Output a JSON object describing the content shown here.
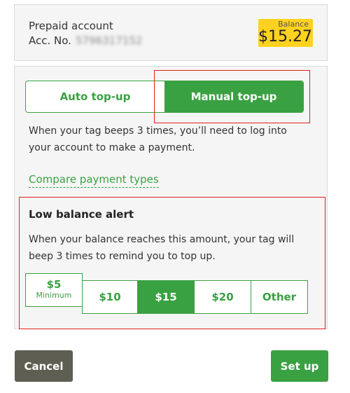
{
  "account": {
    "type_label": "Prepaid account",
    "acc_no_label": "Acc. No.",
    "acc_no_value": "5796317152",
    "balance_label": "Balance",
    "balance_amount": "$15.27"
  },
  "topup": {
    "tabs": [
      {
        "label": "Auto top-up",
        "active": false
      },
      {
        "label": "Manual top-up",
        "active": true
      }
    ],
    "description": "When your tag beeps 3 times, you’ll need to log into your account to make a payment.",
    "compare_link": "Compare payment types"
  },
  "alert": {
    "title": "Low balance alert",
    "description": "When your balance reaches this amount, your tag will beep 3 times to remind you to top up.",
    "amounts": [
      {
        "label": "$5",
        "sublabel": "Minimum",
        "selected": false
      },
      {
        "label": "$10",
        "selected": false
      },
      {
        "label": "$15",
        "selected": true
      },
      {
        "label": "$20",
        "selected": false
      },
      {
        "label": "Other",
        "selected": false
      }
    ]
  },
  "actions": {
    "cancel_label": "Cancel",
    "setup_label": "Set up"
  },
  "colors": {
    "accent": "#3aa142",
    "balance_bg": "#ffd21f",
    "highlight": "#e0201c",
    "cancel_bg": "#5e5e52"
  }
}
